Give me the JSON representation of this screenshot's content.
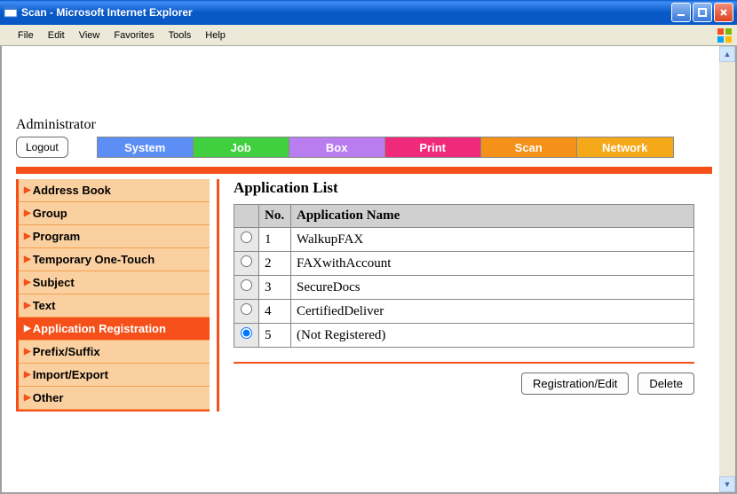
{
  "window": {
    "title": "Scan - Microsoft Internet Explorer"
  },
  "menubar": [
    "File",
    "Edit",
    "View",
    "Favorites",
    "Tools",
    "Help"
  ],
  "admin_label": "Administrator",
  "logout_label": "Logout",
  "tabs": [
    {
      "label": "System",
      "color": "#5c8ef5"
    },
    {
      "label": "Job",
      "color": "#3fcf3f"
    },
    {
      "label": "Box",
      "color": "#b97df0"
    },
    {
      "label": "Print",
      "color": "#ef2a7a"
    },
    {
      "label": "Scan",
      "color": "#f59018"
    },
    {
      "label": "Network",
      "color": "#f5a818"
    }
  ],
  "sidebar": [
    {
      "label": "Address Book",
      "active": false
    },
    {
      "label": "Group",
      "active": false
    },
    {
      "label": "Program",
      "active": false
    },
    {
      "label": "Temporary One-Touch",
      "active": false
    },
    {
      "label": "Subject",
      "active": false
    },
    {
      "label": "Text",
      "active": false
    },
    {
      "label": "Application Registration",
      "active": true
    },
    {
      "label": "Prefix/Suffix",
      "active": false
    },
    {
      "label": "Import/Export",
      "active": false
    },
    {
      "label": "Other",
      "active": false
    }
  ],
  "main": {
    "heading": "Application List",
    "columns": {
      "no": "No.",
      "name": "Application Name"
    },
    "rows": [
      {
        "no": "1",
        "name": "WalkupFAX",
        "selected": false
      },
      {
        "no": "2",
        "name": "FAXwithAccount",
        "selected": false
      },
      {
        "no": "3",
        "name": "SecureDocs",
        "selected": false
      },
      {
        "no": "4",
        "name": "CertifiedDeliver",
        "selected": false
      },
      {
        "no": "5",
        "name": "(Not Registered)",
        "selected": true
      }
    ],
    "actions": {
      "edit": "Registration/Edit",
      "delete": "Delete"
    }
  }
}
